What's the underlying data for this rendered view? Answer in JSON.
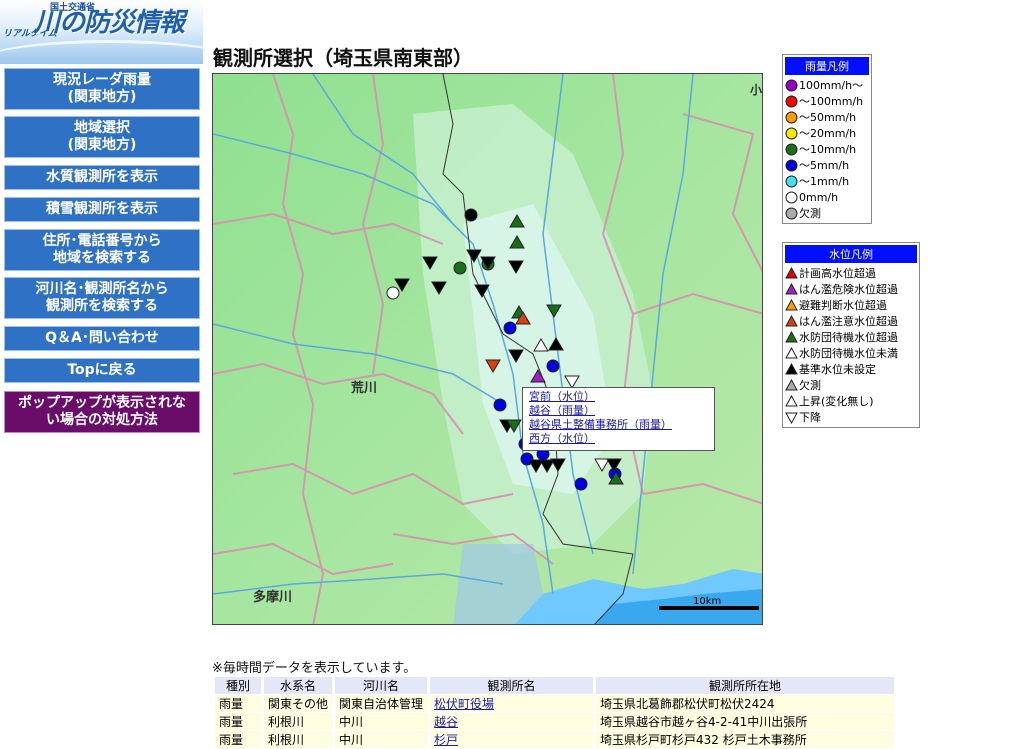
{
  "logo": {
    "small": "国土交通省",
    "kana": "リアルタイム",
    "main": "川の防災情報"
  },
  "nav": [
    {
      "l1": "現況レーダ雨量",
      "l2": "(関東地方)"
    },
    {
      "l1": "地域選択",
      "l2": "(関東地方)"
    },
    {
      "l1": "水質観測所を表示",
      "l2": ""
    },
    {
      "l1": "積雪観測所を表示",
      "l2": ""
    },
    {
      "l1": "住所･電話番号から",
      "l2": "地域を検索する"
    },
    {
      "l1": "河川名･観測所名から",
      "l2": "観測所を検索する"
    },
    {
      "l1": "Q＆A･問い合わせ",
      "l2": ""
    },
    {
      "l1": "Topに戻る",
      "l2": ""
    },
    {
      "l1": "ポップアップが表示されな",
      "l2": "い場合の対処方法"
    }
  ],
  "page_title": "観測所選択（埼玉県南東部）",
  "map": {
    "river_labels": [
      "荒川",
      "多摩川"
    ],
    "edge_label": "小",
    "scale_label": "10km"
  },
  "popup": {
    "links": [
      "宮前（水位）",
      "越谷（雨量）",
      "越谷県土整備事務所（雨量）",
      "西方（水位）"
    ]
  },
  "rain_legend": {
    "title": "雨量凡例",
    "items": [
      {
        "label": "100mm/h～",
        "color": "#9b00c8"
      },
      {
        "label": "～100mm/h",
        "color": "#ff0000"
      },
      {
        "label": "～50mm/h",
        "color": "#ff9900"
      },
      {
        "label": "～20mm/h",
        "color": "#ffe600"
      },
      {
        "label": "～10mm/h",
        "color": "#1a6e1a"
      },
      {
        "label": "～5mm/h",
        "color": "#0000e0"
      },
      {
        "label": "～1mm/h",
        "color": "#40e0f0"
      },
      {
        "label": "0mm/h",
        "color": "#ffffff"
      },
      {
        "label": "欠測",
        "color": "#aaaaaa"
      }
    ]
  },
  "water_legend": {
    "title": "水位凡例",
    "items": [
      {
        "label": "計画高水位超過",
        "color": "#e00000",
        "dir": "up"
      },
      {
        "label": "はん濫危険水位超過",
        "color": "#a020c0",
        "dir": "up"
      },
      {
        "label": "避難判断水位超過",
        "color": "#ff9900",
        "dir": "up"
      },
      {
        "label": "はん濫注意水位超過",
        "color": "#d84010",
        "dir": "up"
      },
      {
        "label": "水防団待機水位超過",
        "color": "#1a6e1a",
        "dir": "up"
      },
      {
        "label": "水防団待機水位未満",
        "color": "#ffffff",
        "dir": "up"
      },
      {
        "label": "基準水位未設定",
        "color": "#000000",
        "dir": "up"
      },
      {
        "label": "欠測",
        "color": "#aaaaaa",
        "dir": "up"
      },
      {
        "label": "上昇(変化無し)",
        "color": "#ffffff",
        "dir": "up"
      },
      {
        "label": "下降",
        "color": "#ffffff",
        "dir": "down"
      }
    ]
  },
  "note": "※毎時間データを表示しています。",
  "table": {
    "headers": [
      "種別",
      "水系名",
      "河川名",
      "観測所名",
      "観測所所在地"
    ],
    "rows": [
      [
        "雨量",
        "関東その他",
        "関東自治体管理",
        "松伏町役場",
        "埼玉県北葛飾郡松伏町松伏2424"
      ],
      [
        "雨量",
        "利根川",
        "中川",
        "越谷",
        "埼玉県越谷市越ヶ谷4-2-41中川出張所"
      ],
      [
        "雨量",
        "利根川",
        "中川",
        "杉戸",
        "埼玉県杉戸町杉戸432 杉戸土木事務所"
      ]
    ]
  }
}
